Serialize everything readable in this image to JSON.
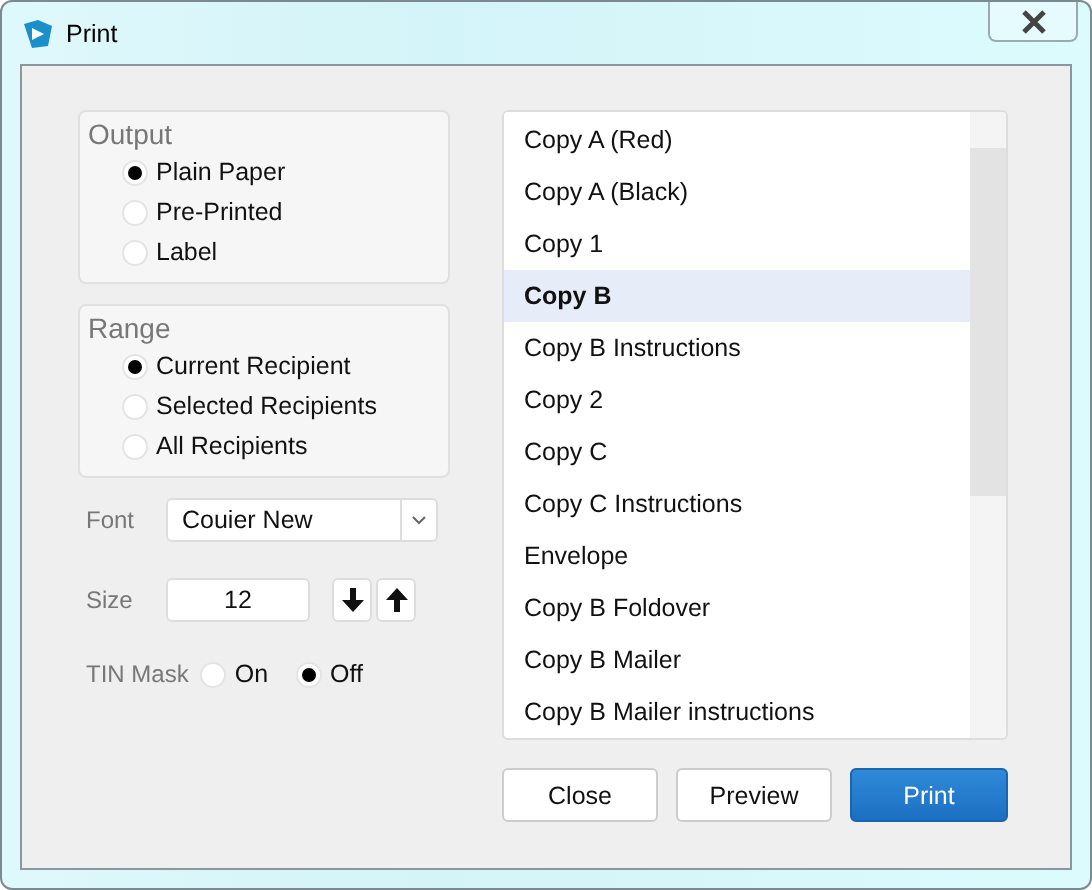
{
  "window": {
    "title": "Print"
  },
  "output": {
    "title": "Output",
    "options": [
      {
        "label": "Plain Paper",
        "selected": true
      },
      {
        "label": "Pre-Printed",
        "selected": false
      },
      {
        "label": "Label",
        "selected": false
      }
    ]
  },
  "range": {
    "title": "Range",
    "options": [
      {
        "label": "Current Recipient",
        "selected": true
      },
      {
        "label": "Selected Recipients",
        "selected": false
      },
      {
        "label": "All Recipients",
        "selected": false
      }
    ]
  },
  "font": {
    "label": "Font",
    "value": "Couier New"
  },
  "size": {
    "label": "Size",
    "value": "12"
  },
  "tin_mask": {
    "label": "TIN Mask",
    "options": [
      {
        "label": "On",
        "selected": false
      },
      {
        "label": "Off",
        "selected": true
      }
    ]
  },
  "copies": [
    {
      "label": "Copy A (Red)",
      "selected": false
    },
    {
      "label": "Copy A (Black)",
      "selected": false
    },
    {
      "label": "Copy 1",
      "selected": false
    },
    {
      "label": "Copy B",
      "selected": true
    },
    {
      "label": "Copy B Instructions",
      "selected": false
    },
    {
      "label": "Copy 2",
      "selected": false
    },
    {
      "label": "Copy C",
      "selected": false
    },
    {
      "label": "Copy C Instructions",
      "selected": false
    },
    {
      "label": "Envelope",
      "selected": false
    },
    {
      "label": "Copy B Foldover",
      "selected": false
    },
    {
      "label": "Copy B Mailer",
      "selected": false
    },
    {
      "label": "Copy B Mailer instructions",
      "selected": false
    }
  ],
  "buttons": [
    {
      "label": "Close",
      "kind": "secondary"
    },
    {
      "label": "Preview",
      "kind": "secondary"
    },
    {
      "label": "Print",
      "kind": "primary"
    }
  ]
}
